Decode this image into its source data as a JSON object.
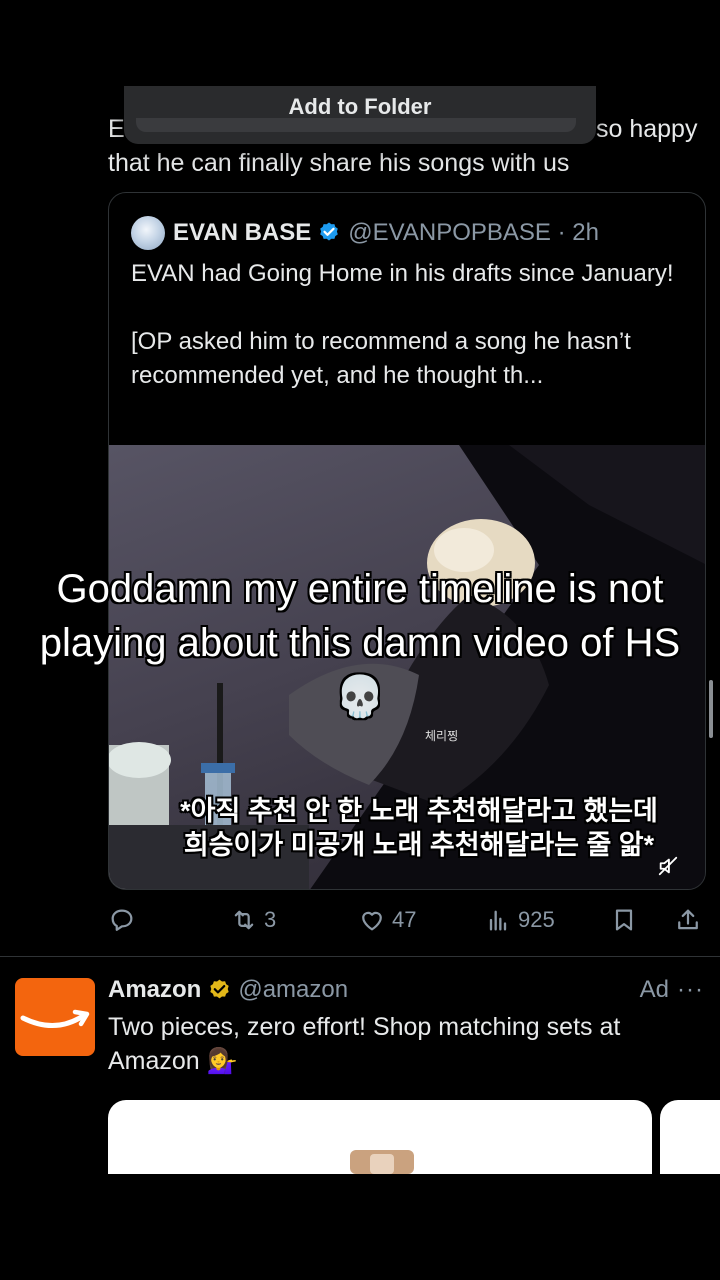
{
  "menu_popup": {
    "label": "Add to Folder"
  },
  "tweet": {
    "text_left": "E\\",
    "text_right": "so happy",
    "text_line2": "that he can finally share his songs with us"
  },
  "quote": {
    "name": "EVAN BASE",
    "handle": "@EVANPOPBASE · 2h",
    "text1": "EVAN had Going Home in his drafts since January!",
    "text2": "[OP asked him to recommend a song he hasn’t recommended yet, and he thought th...",
    "media": {
      "small_text": "체리찡",
      "subtitle_line1": "*아직 추천 안 한 노래 추천해달라고 했는데",
      "subtitle_line2": "희승이가 미공개 노래 추천해달라는 줄 앎*"
    }
  },
  "actions": {
    "retweets": "3",
    "likes": "47",
    "views": "925"
  },
  "ad": {
    "name": "Amazon",
    "handle": "@amazon",
    "label": "Ad",
    "more": "···",
    "text": "Two pieces, zero effort! Shop matching sets at Amazon 💁‍♀️"
  },
  "overlay_caption": "Goddamn my entire timeline is not playing about this damn video of HS💀",
  "colors": {
    "background": "#000000",
    "verified_blue": "#1d9bf0",
    "amazon_orange": "#f3650e",
    "gold_badge": "#e2b719",
    "muted_text": "#8b98a5"
  },
  "icons": [
    "reply-icon",
    "retweet-icon",
    "like-icon",
    "views-icon",
    "bookmark-icon",
    "share-icon",
    "mute-icon",
    "verified-icon",
    "gold-verified-icon",
    "amazon-logo"
  ]
}
